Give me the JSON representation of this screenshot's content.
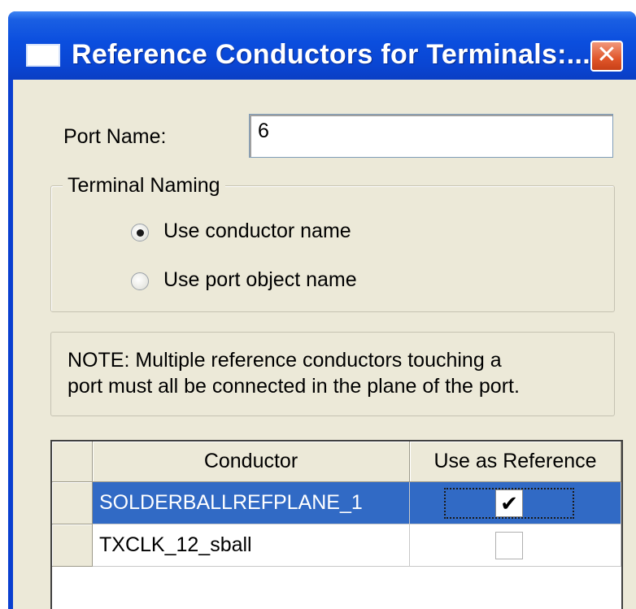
{
  "window": {
    "title": "Reference Conductors for Terminals:...",
    "close_glyph": "✕",
    "app_icon": "window-icon"
  },
  "port": {
    "label": "Port Name:",
    "value": "6"
  },
  "terminal_naming": {
    "legend": "Terminal Naming",
    "options": [
      {
        "label": "Use conductor name",
        "selected": true
      },
      {
        "label": "Use port object name",
        "selected": false
      }
    ]
  },
  "note": {
    "line1": "NOTE: Multiple reference conductors touching a",
    "line2": "port must all be connected in the plane of the port."
  },
  "table": {
    "columns": [
      "Conductor",
      "Use as Reference"
    ],
    "rows": [
      {
        "conductor": "SOLDERBALLREFPLANE_1",
        "use_as_reference": true,
        "selected": true,
        "check_glyph": "✔"
      },
      {
        "conductor": "TXCLK_12_sball",
        "use_as_reference": false,
        "selected": false,
        "check_glyph": ""
      }
    ]
  },
  "colors": {
    "titlebar": "#0a45d2",
    "dialog_bg": "#ece9d8",
    "selection": "#316ac5",
    "close_button": "#e0562a"
  }
}
